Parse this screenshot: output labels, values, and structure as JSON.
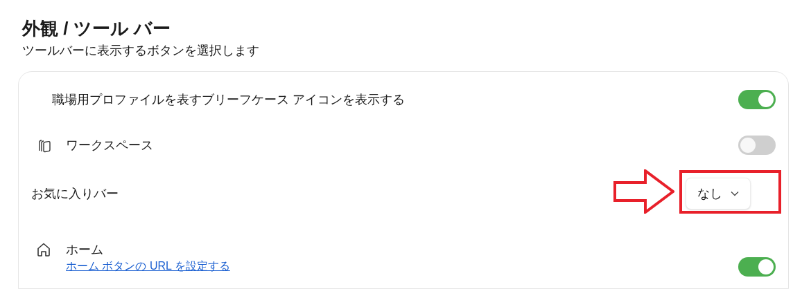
{
  "header": {
    "title": "外観 / ツール バー",
    "subtitle": "ツールバーに表示するボタンを選択します"
  },
  "settings": [
    {
      "kind": "toggle",
      "label": "職場用プロファイルを表すブリーフケース アイコンを表示する",
      "on": true
    },
    {
      "kind": "toggle",
      "label": "ワークスペース",
      "on": false
    },
    {
      "kind": "dropdown",
      "label": "お気に入りバー",
      "value": "なし",
      "highlighted": true
    },
    {
      "kind": "toggle",
      "label": "ホーム",
      "link": "ホーム ボタンの URL を設定する",
      "on": true
    }
  ]
}
